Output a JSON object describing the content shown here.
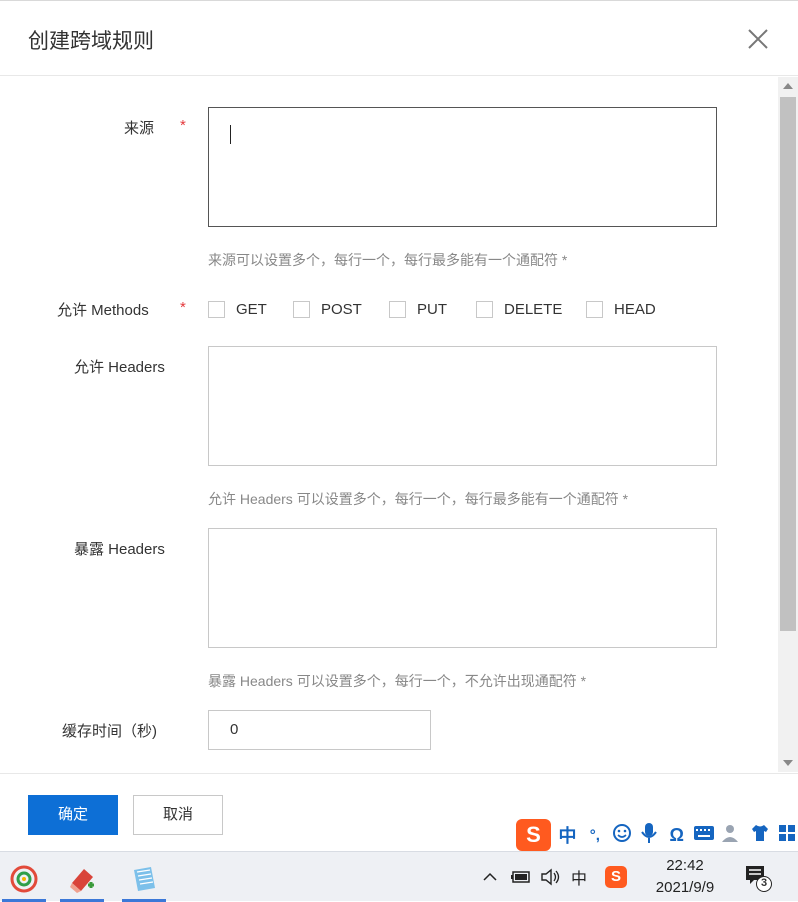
{
  "dialog": {
    "title": "创建跨域规则",
    "close_icon": "close-icon"
  },
  "form": {
    "origin": {
      "label": "来源",
      "required_mark": "*",
      "value": "",
      "hint": "来源可以设置多个，每行一个，每行最多能有一个通配符 *"
    },
    "methods": {
      "label": "允许 Methods",
      "required_mark": "*",
      "options": [
        {
          "label": "GET",
          "checked": false
        },
        {
          "label": "POST",
          "checked": false
        },
        {
          "label": "PUT",
          "checked": false
        },
        {
          "label": "DELETE",
          "checked": false
        },
        {
          "label": "HEAD",
          "checked": false
        }
      ]
    },
    "allow_headers": {
      "label": "允许 Headers",
      "value": "",
      "hint": "允许 Headers 可以设置多个，每行一个，每行最多能有一个通配符 *"
    },
    "expose_headers": {
      "label": "暴露 Headers",
      "value": "",
      "hint": "暴露 Headers 可以设置多个，每行一个，不允许出现通配符 *"
    },
    "cache_time": {
      "label": "缓存时间（秒)",
      "value": "0"
    }
  },
  "footer": {
    "confirm_label": "确定",
    "cancel_label": "取消"
  },
  "ime_toolbar": {
    "logo": "S",
    "mode": "中",
    "punct": "°,",
    "items": [
      "smiley-icon",
      "microphone-icon",
      "omega-icon",
      "keyboard-icon",
      "user-icon",
      "shirt-icon",
      "grid-icon"
    ]
  },
  "taskbar": {
    "tray_ime": "中",
    "time": "22:42",
    "date": "2021/9/9",
    "notification_count": "3"
  },
  "colors": {
    "primary": "#0d6fd6",
    "required": "#e4393c",
    "ime_brand": "#ff5a1f"
  }
}
